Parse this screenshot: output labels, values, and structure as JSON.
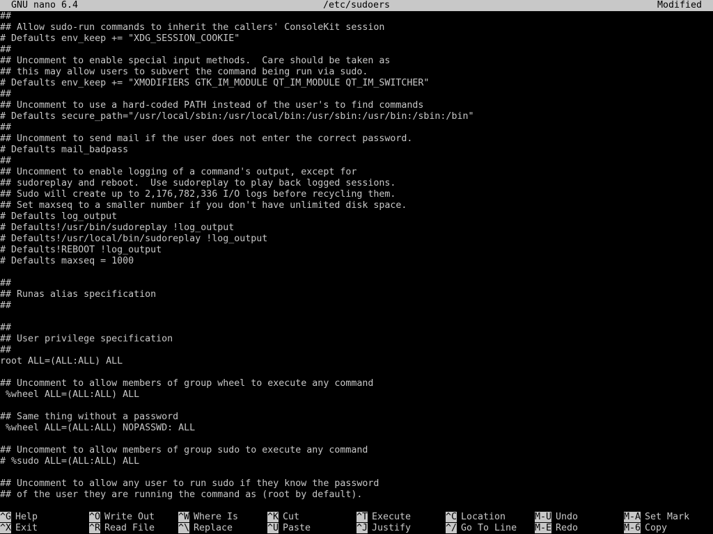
{
  "titlebar": {
    "app": "GNU nano 6.4",
    "filename": "/etc/sudoers",
    "status": "Modified"
  },
  "editor": {
    "lines": [
      "##",
      "## Allow sudo-run commands to inherit the callers' ConsoleKit session",
      "# Defaults env_keep += \"XDG_SESSION_COOKIE\"",
      "##",
      "## Uncomment to enable special input methods.  Care should be taken as",
      "## this may allow users to subvert the command being run via sudo.",
      "# Defaults env_keep += \"XMODIFIERS GTK_IM_MODULE QT_IM_MODULE QT_IM_SWITCHER\"",
      "##",
      "## Uncomment to use a hard-coded PATH instead of the user's to find commands",
      "# Defaults secure_path=\"/usr/local/sbin:/usr/local/bin:/usr/sbin:/usr/bin:/sbin:/bin\"",
      "##",
      "## Uncomment to send mail if the user does not enter the correct password.",
      "# Defaults mail_badpass",
      "##",
      "## Uncomment to enable logging of a command's output, except for",
      "## sudoreplay and reboot.  Use sudoreplay to play back logged sessions.",
      "## Sudo will create up to 2,176,782,336 I/O logs before recycling them.",
      "## Set maxseq to a smaller number if you don't have unlimited disk space.",
      "# Defaults log_output",
      "# Defaults!/usr/bin/sudoreplay !log_output",
      "# Defaults!/usr/local/bin/sudoreplay !log_output",
      "# Defaults!REBOOT !log_output",
      "# Defaults maxseq = 1000",
      "",
      "##",
      "## Runas alias specification",
      "##",
      "",
      "##",
      "## User privilege specification",
      "##",
      "root ALL=(ALL:ALL) ALL",
      "",
      "## Uncomment to allow members of group wheel to execute any command",
      " %wheel ALL=(ALL:ALL) ALL",
      "",
      "## Same thing without a password",
      " %wheel ALL=(ALL:ALL) NOPASSWD: ALL",
      "",
      "## Uncomment to allow members of group sudo to execute any command",
      "# %sudo ALL=(ALL:ALL) ALL",
      "",
      "## Uncomment to allow any user to run sudo if they know the password",
      "## of the user they are running the command as (root by default)."
    ]
  },
  "shortcuts": {
    "row1": [
      {
        "key": "^G",
        "label": "Help"
      },
      {
        "key": "^O",
        "label": "Write Out"
      },
      {
        "key": "^W",
        "label": "Where Is"
      },
      {
        "key": "^K",
        "label": "Cut"
      },
      {
        "key": "^T",
        "label": "Execute"
      },
      {
        "key": "^C",
        "label": "Location"
      },
      {
        "key": "M-U",
        "label": "Undo"
      },
      {
        "key": "M-A",
        "label": "Set Mark"
      }
    ],
    "row2": [
      {
        "key": "^X",
        "label": "Exit"
      },
      {
        "key": "^R",
        "label": "Read File"
      },
      {
        "key": "^\\",
        "label": "Replace"
      },
      {
        "key": "^U",
        "label": "Paste"
      },
      {
        "key": "^J",
        "label": "Justify"
      },
      {
        "key": "^/",
        "label": "Go To Line"
      },
      {
        "key": "M-E",
        "label": "Redo"
      },
      {
        "key": "M-6",
        "label": "Copy"
      }
    ]
  },
  "colors": {
    "background": "#000000",
    "foreground": "#c8c8c8",
    "inverse_bg": "#c8c8c8",
    "inverse_fg": "#000000"
  }
}
